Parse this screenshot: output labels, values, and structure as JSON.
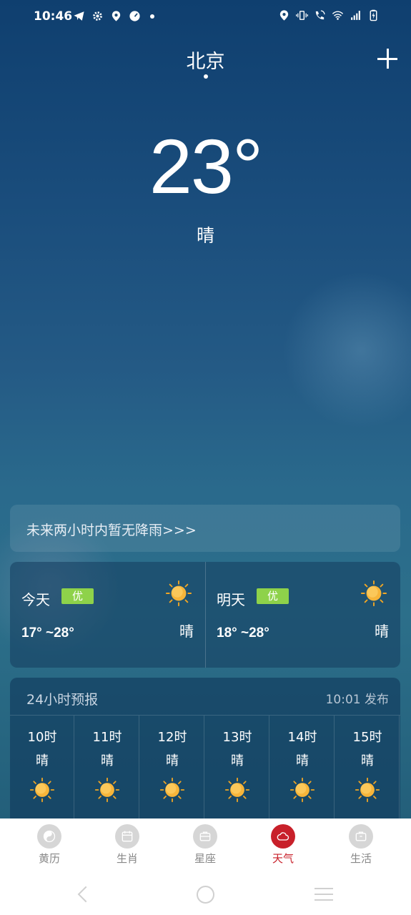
{
  "status_bar": {
    "time": "10:46"
  },
  "header": {
    "city": "北京"
  },
  "current": {
    "temperature": "23°",
    "condition": "晴"
  },
  "rain_notice": "未来两小时内暂无降雨>>>",
  "days": [
    {
      "label": "今天",
      "aqi": "优",
      "range": "17° ~28°",
      "condition": "晴",
      "icon": "sun-icon"
    },
    {
      "label": "明天",
      "aqi": "优",
      "range": "18° ~28°",
      "condition": "晴",
      "icon": "sun-icon"
    }
  ],
  "hourly": {
    "title": "24小时预报",
    "published": "10:01 发布",
    "hours": [
      {
        "time": "10时",
        "condition": "晴",
        "icon": "sun-icon"
      },
      {
        "time": "11时",
        "condition": "晴",
        "icon": "sun-icon"
      },
      {
        "time": "12时",
        "condition": "晴",
        "icon": "sun-icon"
      },
      {
        "time": "13时",
        "condition": "晴",
        "icon": "sun-icon"
      },
      {
        "time": "14时",
        "condition": "晴",
        "icon": "sun-icon"
      },
      {
        "time": "15时",
        "condition": "晴",
        "icon": "sun-icon"
      }
    ]
  },
  "bottom_nav": {
    "items": [
      {
        "label": "黄历",
        "icon": "yin-yang-icon",
        "active": false
      },
      {
        "label": "生肖",
        "icon": "calendar-icon",
        "active": false
      },
      {
        "label": "星座",
        "icon": "box-icon",
        "active": false
      },
      {
        "label": "天气",
        "icon": "cloud-icon",
        "active": true
      },
      {
        "label": "生活",
        "icon": "briefcase-icon",
        "active": false
      }
    ]
  },
  "colors": {
    "accent": "#c8202a",
    "aqi_good": "#8ed24a",
    "sky_top": "#0f3f6f",
    "sky_bottom": "#2c6f8a"
  }
}
